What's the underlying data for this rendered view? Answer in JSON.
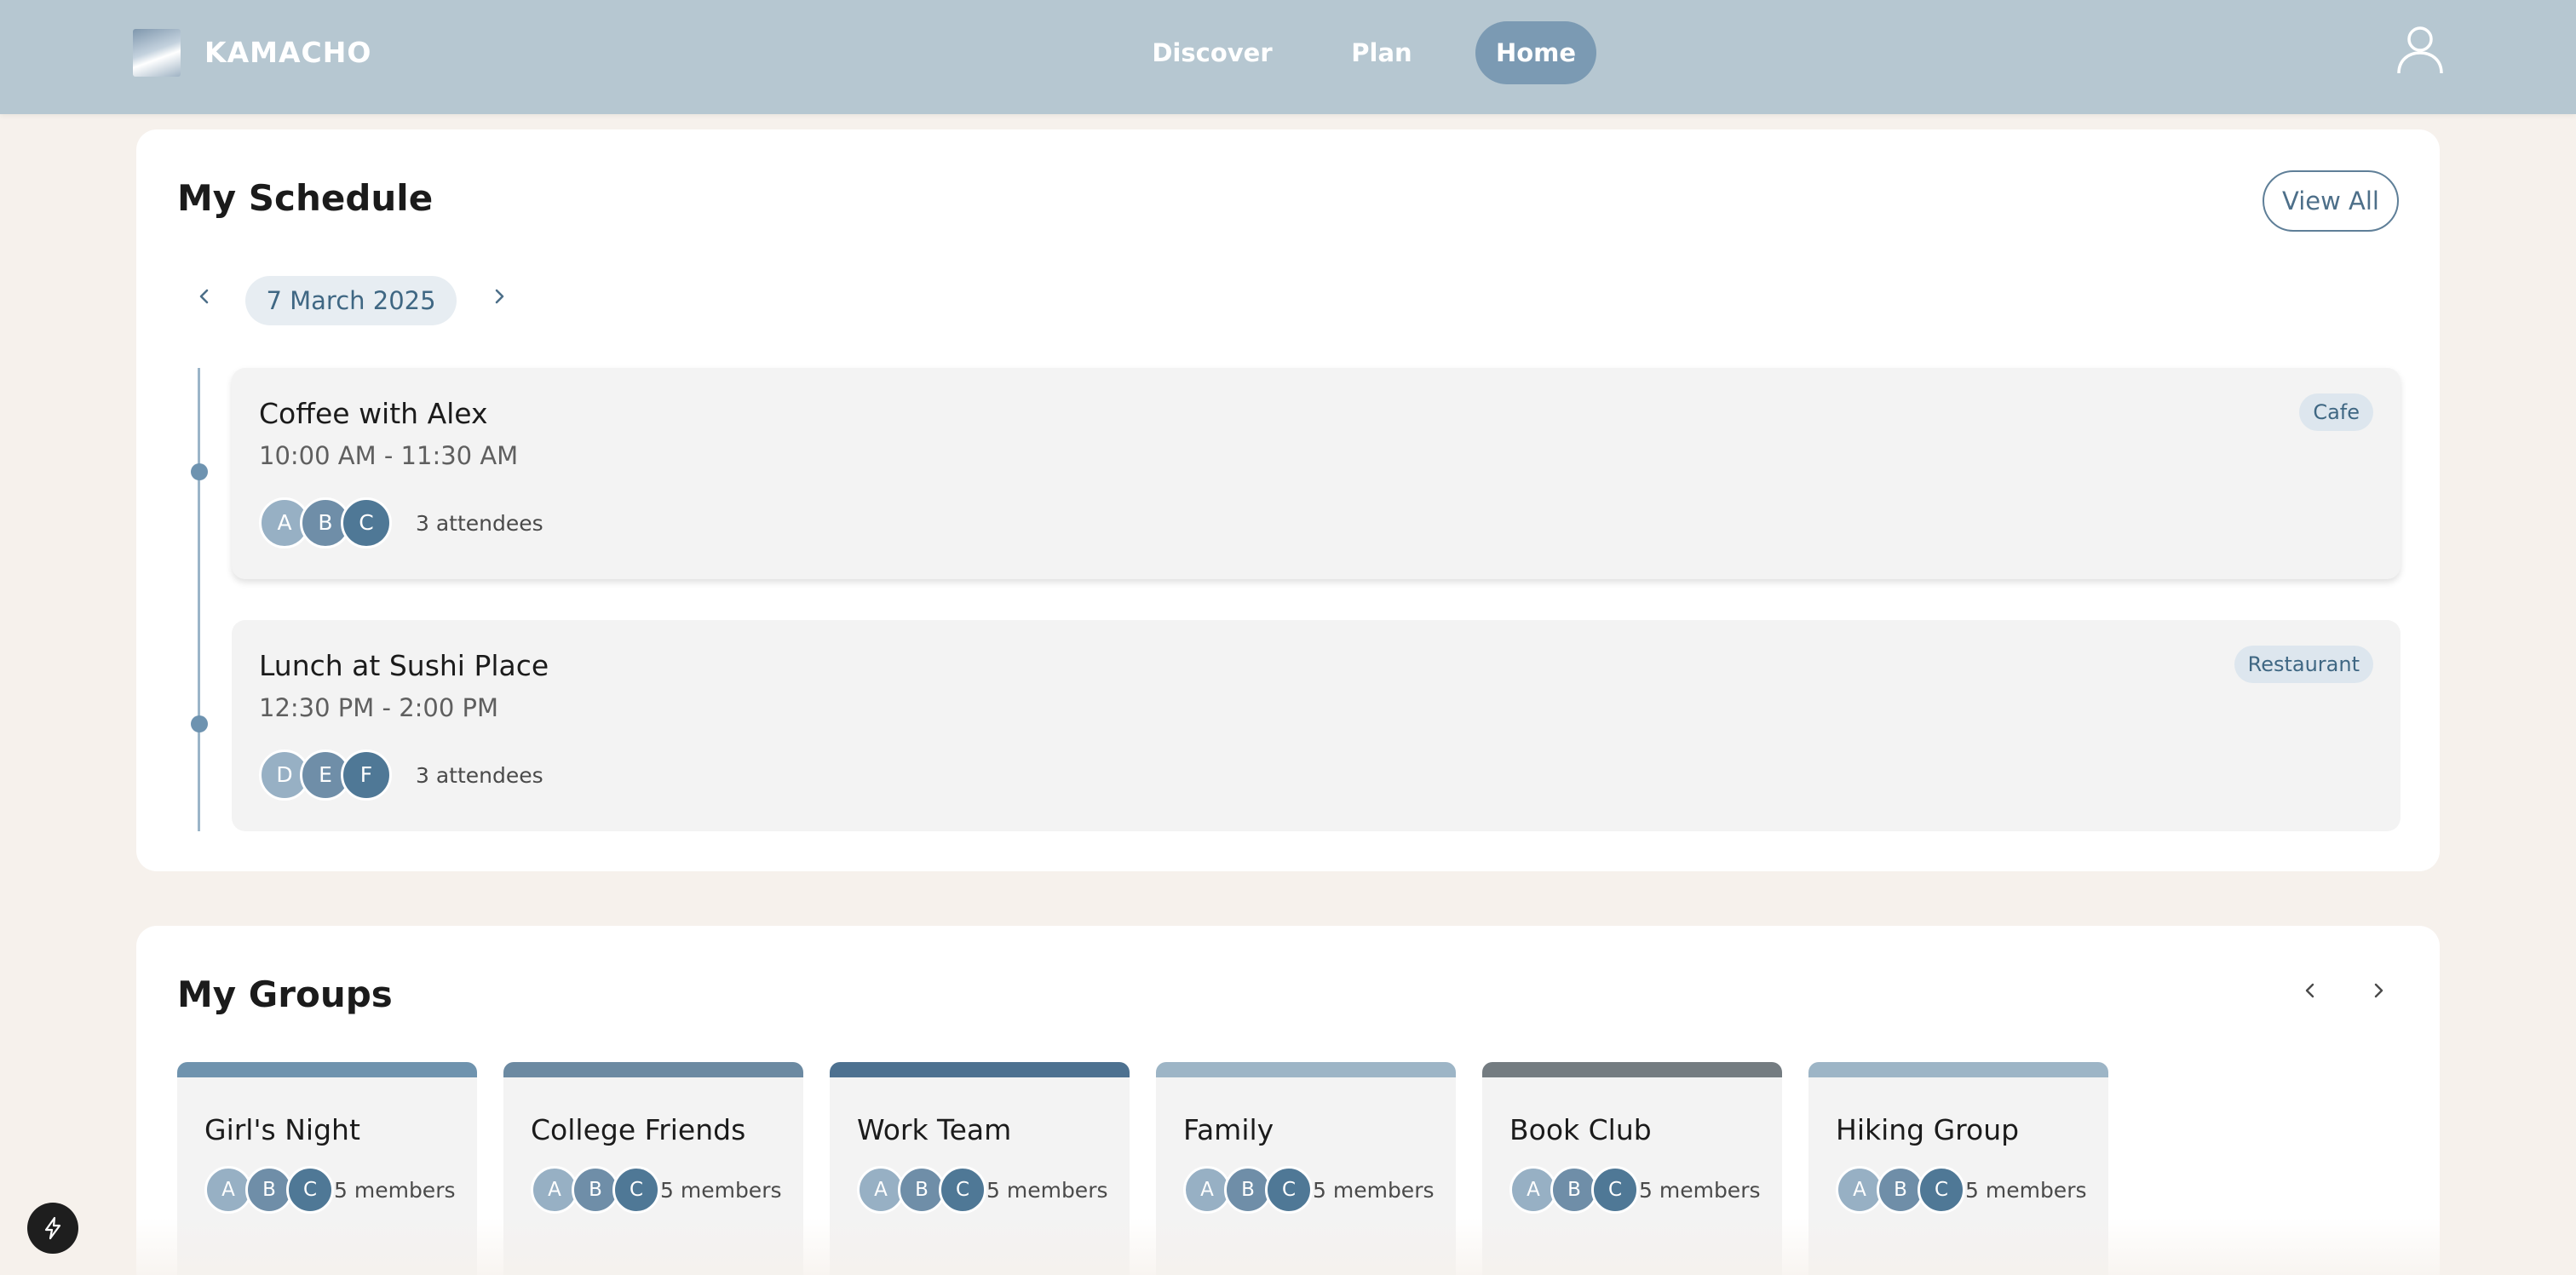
{
  "header": {
    "brand": "KAMACHO",
    "nav": [
      {
        "label": "Discover"
      },
      {
        "label": "Plan"
      },
      {
        "label": "Home",
        "active": true
      }
    ],
    "user_icon": "user-icon",
    "background": "#b6c7d1",
    "active_nav_color": "#7b9ab3"
  },
  "schedule": {
    "title": "My Schedule",
    "view_all_label": "View All",
    "date": "7 March 2025",
    "prev_icon": "chevron-left-icon",
    "next_icon": "chevron-right-icon",
    "events": [
      {
        "title": "Coffee with Alex",
        "time": "10:00 AM - 11:30 AM",
        "tag": "Cafe",
        "attendees": [
          "A",
          "B",
          "C"
        ],
        "attendees_label": "3 attendees"
      },
      {
        "title": "Lunch at Sushi Place",
        "time": "12:30 PM - 2:00 PM",
        "tag": "Restaurant",
        "attendees": [
          "D",
          "E",
          "F"
        ],
        "attendees_label": "3 attendees"
      }
    ]
  },
  "groups": {
    "title": "My Groups",
    "prev_icon": "chevron-left-icon",
    "next_icon": "chevron-right-icon",
    "items": [
      {
        "name": "Girl's Night",
        "members": [
          "A",
          "B",
          "C"
        ],
        "members_label": "5 members",
        "color": "#6f93ae"
      },
      {
        "name": "College Friends",
        "members": [
          "A",
          "B",
          "C"
        ],
        "members_label": "5 members",
        "color": "#6c8aa2"
      },
      {
        "name": "Work Team",
        "members": [
          "A",
          "B",
          "C"
        ],
        "members_label": "5 members",
        "color": "#4d7190"
      },
      {
        "name": "Family",
        "members": [
          "A",
          "B",
          "C"
        ],
        "members_label": "5 members",
        "color": "#9db5c6"
      },
      {
        "name": "Book Club",
        "members": [
          "A",
          "B",
          "C"
        ],
        "members_label": "5 members",
        "color": "#747c81"
      },
      {
        "name": "Hiking Group",
        "members": [
          "A",
          "B",
          "C"
        ],
        "members_label": "5 members",
        "color": "#9db5c6"
      }
    ]
  },
  "fab_icon": "lightning-icon"
}
